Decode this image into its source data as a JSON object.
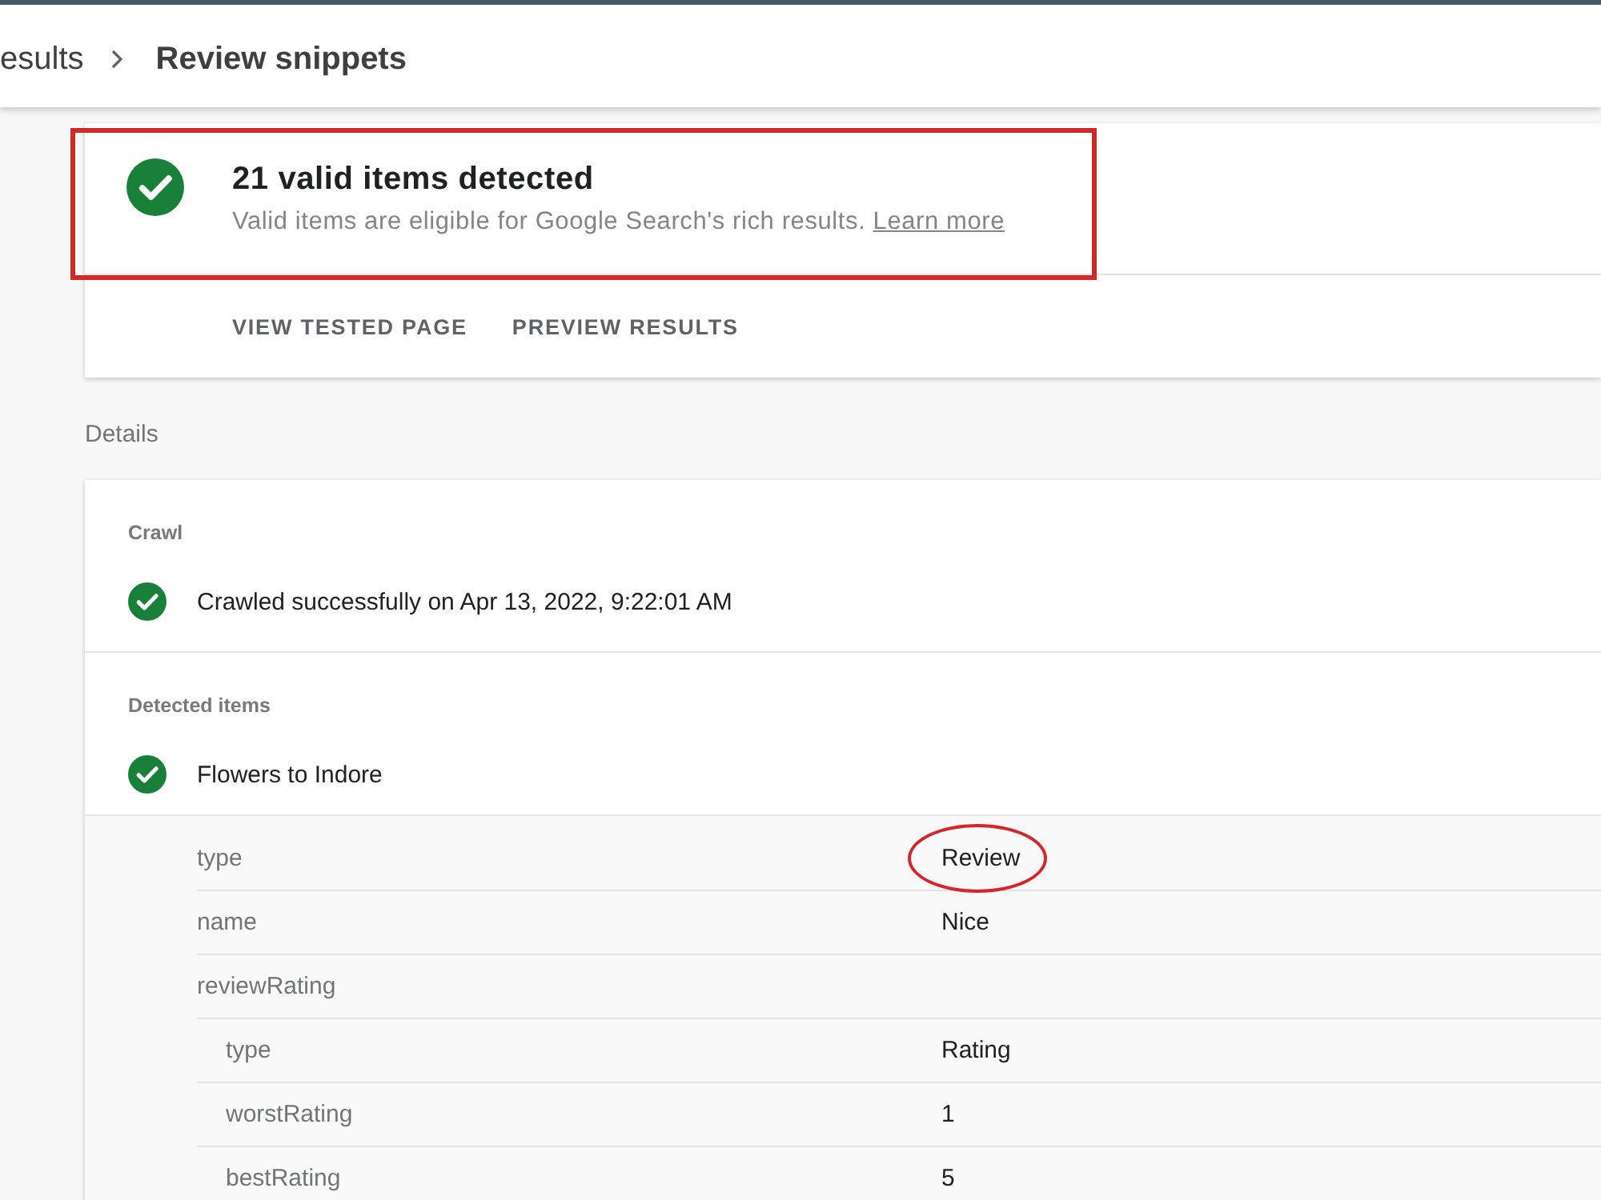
{
  "top_bar": {
    "breadcrumbs": [
      {
        "label": "esults",
        "current": false
      },
      {
        "label": "Review snippets",
        "current": true
      }
    ]
  },
  "summary": {
    "title": "21 valid items detected",
    "description": "Valid items are eligible for Google Search's rich results.",
    "link": "Learn more",
    "highlighted": true,
    "actions": [
      "VIEW TESTED PAGE",
      "PREVIEW RESULTS"
    ]
  },
  "details": {
    "heading": "Details",
    "sections": [
      {
        "label": "Crawl",
        "entries": [
          {
            "text": "Crawled successfully on Apr 13, 2022, 9:22:01 AM"
          }
        ]
      },
      {
        "label": "Detected items",
        "entries": [
          {
            "text": "Flowers to Indore",
            "properties": [
              {
                "key": "type",
                "value": "Review",
                "circled": true
              },
              {
                "key": "name",
                "value": "Nice",
                "circled": false
              },
              {
                "key": "reviewRating",
                "circled": false,
                "children": [
                  {
                    "key": "type",
                    "value": "Rating",
                    "circled": false
                  },
                  {
                    "key": "worstRating",
                    "value": "1",
                    "circled": false
                  },
                  {
                    "key": "bestRating",
                    "value": "5",
                    "circled": false
                  }
                ]
              }
            ]
          }
        ]
      }
    ]
  }
}
